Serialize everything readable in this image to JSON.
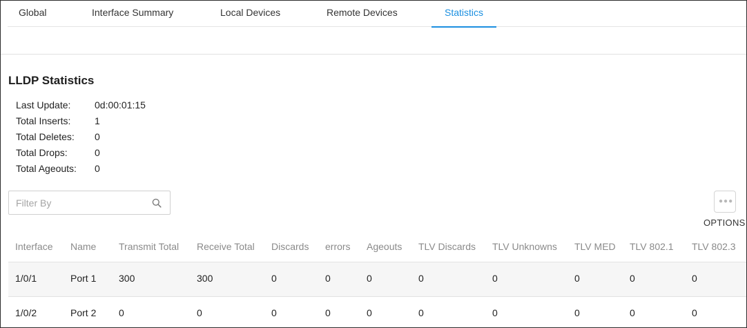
{
  "tabs": [
    {
      "label": "Global",
      "active": false
    },
    {
      "label": "Interface Summary",
      "active": false
    },
    {
      "label": "Local Devices",
      "active": false
    },
    {
      "label": "Remote Devices",
      "active": false
    },
    {
      "label": "Statistics",
      "active": true
    }
  ],
  "accent_color": "#1a8fe0",
  "section": {
    "title": "LLDP Statistics"
  },
  "summary": [
    {
      "label": "Last Update:",
      "value": "0d:00:01:15"
    },
    {
      "label": "Total Inserts:",
      "value": "1"
    },
    {
      "label": "Total Deletes:",
      "value": "0"
    },
    {
      "label": "Total Drops:",
      "value": "0"
    },
    {
      "label": "Total Ageouts:",
      "value": "0"
    }
  ],
  "filter": {
    "placeholder": "Filter By",
    "value": "",
    "icon": "search-icon"
  },
  "options": {
    "label": "OPTIONS",
    "icon": "more-dots-icon"
  },
  "table": {
    "columns": [
      "Interface",
      "Name",
      "Transmit Total",
      "Receive Total",
      "Discards",
      "errors",
      "Ageouts",
      "TLV Discards",
      "TLV Unknowns",
      "TLV MED",
      "TLV 802.1",
      "TLV 802.3"
    ],
    "rows": [
      [
        "1/0/1",
        "Port 1",
        "300",
        "300",
        "0",
        "0",
        "0",
        "0",
        "0",
        "0",
        "0",
        "0"
      ],
      [
        "1/0/2",
        "Port 2",
        "0",
        "0",
        "0",
        "0",
        "0",
        "0",
        "0",
        "0",
        "0",
        "0"
      ]
    ]
  }
}
